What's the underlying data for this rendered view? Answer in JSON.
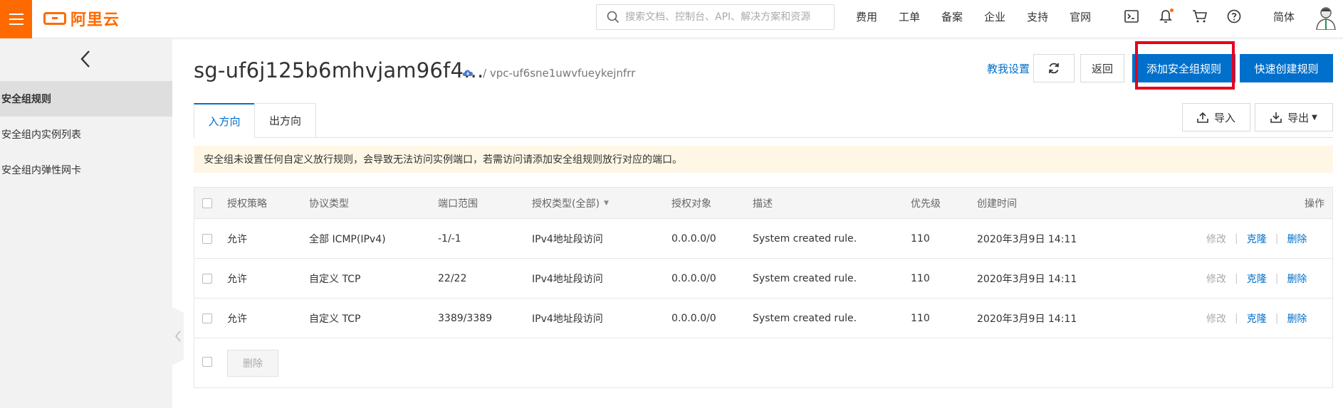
{
  "header": {
    "brand": "阿里云",
    "search_placeholder": "搜索文档、控制台、API、解决方案和资源",
    "nav": [
      "费用",
      "工单",
      "备案",
      "企业",
      "支持",
      "官网"
    ],
    "icons": [
      "terminal-icon",
      "bell-icon",
      "cart-icon",
      "help-icon"
    ],
    "lang": "简体",
    "accent": "#ff6a00"
  },
  "sidebar": {
    "items": [
      {
        "label": "安全组规则",
        "active": true
      },
      {
        "label": "安全组内实例列表",
        "active": false
      },
      {
        "label": "安全组内弹性网卡",
        "active": false
      }
    ]
  },
  "page": {
    "title": "sg-uf6j125b6mhvjam96f4...",
    "vpc": "/ vpc-uf6sne1uwvfueykejnfrr",
    "tutorial": "教我设置",
    "back": "返回",
    "add_rule": "添加安全组规则",
    "quick_create": "快速创建规则",
    "import": "导入",
    "export": "导出",
    "primary_color": "#0070cc"
  },
  "tabs": [
    "入方向",
    "出方向"
  ],
  "notice": "安全组未设置任何自定义放行规则，会导致无法访问实例端口，若需访问请添加安全组规则放行对应的端口。",
  "table": {
    "headers": [
      "授权策略",
      "协议类型",
      "端口范围",
      "授权类型(全部)",
      "授权对象",
      "描述",
      "优先级",
      "创建时间",
      "操作"
    ],
    "rows": [
      {
        "policy": "允许",
        "protocol": "全部 ICMP(IPv4)",
        "port": "-1/-1",
        "auth_type": "IPv4地址段访问",
        "object": "0.0.0.0/0",
        "desc": "System created rule.",
        "priority": "110",
        "created": "2020年3月9日 14:11"
      },
      {
        "policy": "允许",
        "protocol": "自定义 TCP",
        "port": "22/22",
        "auth_type": "IPv4地址段访问",
        "object": "0.0.0.0/0",
        "desc": "System created rule.",
        "priority": "110",
        "created": "2020年3月9日 14:11"
      },
      {
        "policy": "允许",
        "protocol": "自定义 TCP",
        "port": "3389/3389",
        "auth_type": "IPv4地址段访问",
        "object": "0.0.0.0/0",
        "desc": "System created rule.",
        "priority": "110",
        "created": "2020年3月9日 14:11"
      }
    ],
    "actions": {
      "edit": "修改",
      "clone": "克隆",
      "delete": "删除",
      "sep": "|"
    },
    "bulk_delete": "删除"
  }
}
